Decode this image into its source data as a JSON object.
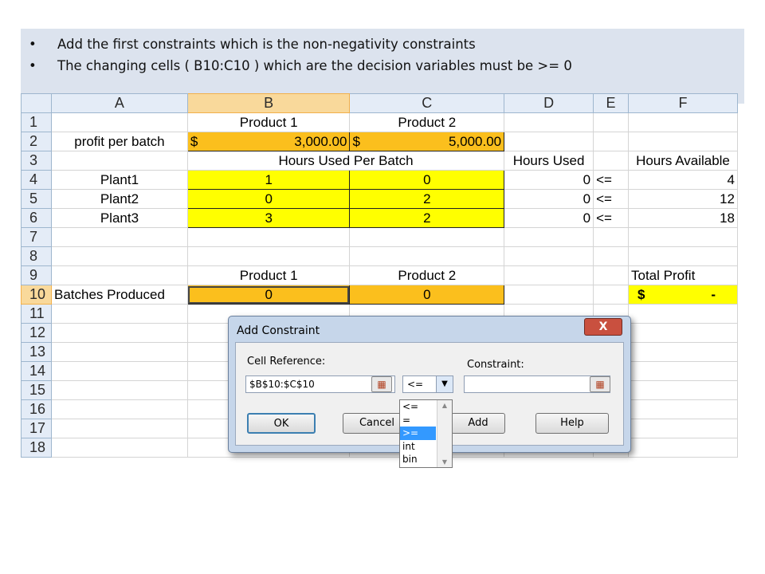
{
  "notes": [
    "Add the first constraints which is the non-negativity constraints",
    "The changing cells ( B10:C10 ) which are the decision variables must be >= 0"
  ],
  "sheet": {
    "columns": [
      "A",
      "B",
      "C",
      "D",
      "E",
      "F"
    ],
    "rows": [
      "1",
      "2",
      "3",
      "4",
      "5",
      "6",
      "7",
      "8",
      "9",
      "10",
      "11",
      "12",
      "13",
      "14",
      "15",
      "16",
      "17",
      "18"
    ],
    "r1": {
      "b": "Product 1",
      "c": "Product 2"
    },
    "r2": {
      "a": "profit per batch",
      "b_sym": "$",
      "b_val": "3,000.00",
      "c_sym": "$",
      "c_val": "5,000.00"
    },
    "r3": {
      "bc": "Hours Used Per Batch",
      "d": "Hours Used",
      "f": "Hours Available"
    },
    "r4": {
      "a": "Plant1",
      "b": "1",
      "c": "0",
      "d": "0",
      "e": "<=",
      "f": "4"
    },
    "r5": {
      "a": "Plant2",
      "b": "0",
      "c": "2",
      "d": "0",
      "e": "<=",
      "f": "12"
    },
    "r6": {
      "a": "Plant3",
      "b": "3",
      "c": "2",
      "d": "0",
      "e": "<=",
      "f": "18"
    },
    "r9": {
      "b": "Product 1",
      "c": "Product 2",
      "f": "Total Profit"
    },
    "r10": {
      "a": "Batches Produced",
      "b": "0",
      "c": "0",
      "f_sym": "$",
      "f_val": "-"
    }
  },
  "dialog": {
    "title": "Add Constraint",
    "close_label": "X",
    "cell_reference_label": "Cell Reference:",
    "cell_reference_value": "$B$10:$C$10",
    "operator_value": "<=",
    "constraint_label": "Constraint:",
    "constraint_value": "",
    "ok_label": "OK",
    "cancel_label": "Cancel",
    "add_label": "Add",
    "help_label": "Help",
    "operator_options": [
      "<=",
      "=",
      ">=",
      "int",
      "bin"
    ],
    "selected_option": ">="
  }
}
